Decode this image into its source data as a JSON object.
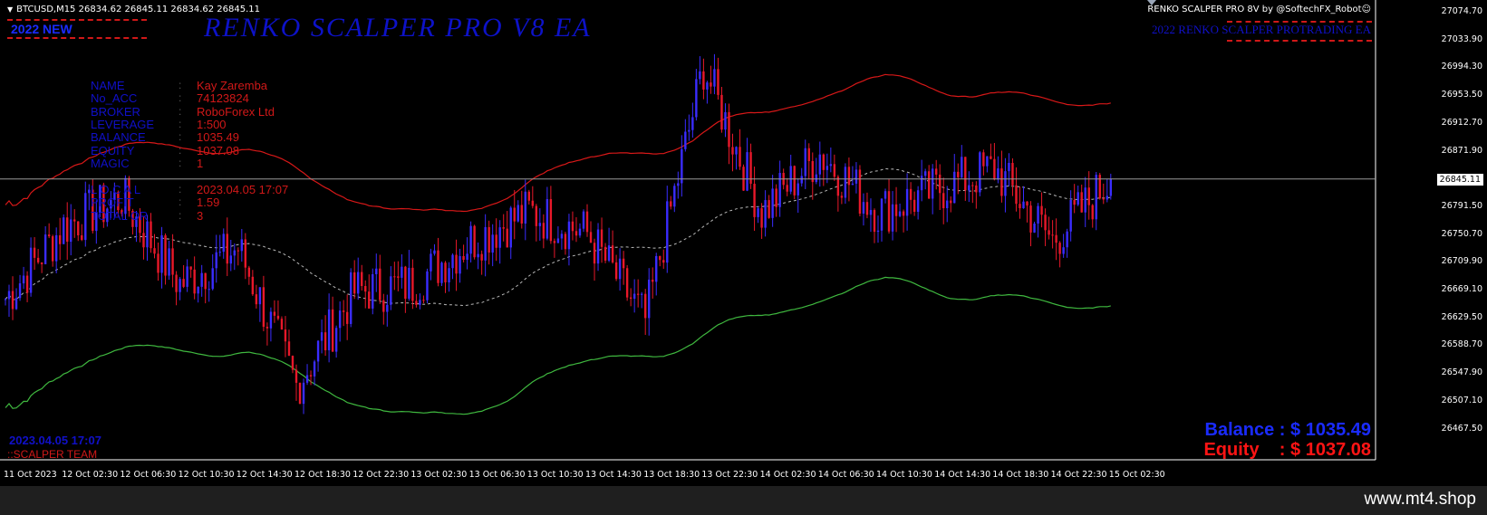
{
  "symbol_bar": {
    "arrow": "▼",
    "text": "BTCUSD,M15  26834.62 26845.11 26834.62 26845.11"
  },
  "overlay": {
    "new_label": "2022 NEW",
    "title": "RENKO SCALPER PRO V8 EA",
    "brand_top": "RENKO SCALPER PRO 8V by @SoftechFX_Robot☺",
    "brand_sub": "2022 RENKO SCALPER PROTRADING EA",
    "balance_text": "Balance : $ 1035.49",
    "equity_text": "Equity    : $ 1037.08",
    "bottom_date": "2023.04.05 17:07",
    "bottom_team": "::SCALPER TEAM"
  },
  "account_info": [
    {
      "label": "NAME",
      "colon": ":",
      "value": "Kay Zaremba"
    },
    {
      "label": "No_ACC",
      "colon": ":",
      "value": "74123824"
    },
    {
      "label": "BROKER",
      "colon": ":",
      "value": "RoboForex Ltd"
    },
    {
      "label": "LEVERAGE",
      "colon": ":",
      "value": "1:500"
    },
    {
      "label": "BALANCE",
      "colon": ":",
      "value": "1035.49"
    },
    {
      "label": "EQUITY",
      "colon": ":",
      "value": "1037.08"
    },
    {
      "label": "MAGIC",
      "colon": ":",
      "value": "1"
    }
  ],
  "trade_info": [
    {
      "label": "L O C A L",
      "colon": ":",
      "value": "2023.04.05 17:07"
    },
    {
      "label": "PROFIT",
      "colon": ":",
      "value": "1.59"
    },
    {
      "label": "TOTAL OR",
      "colon": ":",
      "value": "3"
    }
  ],
  "price_axis": {
    "current": "26845.11",
    "labels": [
      "27074.70",
      "27033.90",
      "26994.30",
      "26953.50",
      "26912.70",
      "26871.90",
      "26832.30",
      "26791.50",
      "26750.70",
      "26709.90",
      "26669.10",
      "26629.50",
      "26588.70",
      "26547.90",
      "26507.10",
      "26467.50"
    ]
  },
  "time_axis": [
    "11 Oct 2023",
    "12 Oct 02:30",
    "12 Oct 06:30",
    "12 Oct 10:30",
    "12 Oct 14:30",
    "12 Oct 18:30",
    "12 Oct 22:30",
    "13 Oct 02:30",
    "13 Oct 06:30",
    "13 Oct 10:30",
    "13 Oct 14:30",
    "13 Oct 18:30",
    "13 Oct 22:30",
    "14 Oct 02:30",
    "14 Oct 06:30",
    "14 Oct 10:30",
    "14 Oct 14:30",
    "14 Oct 18:30",
    "14 Oct 22:30",
    "15 Oct 02:30"
  ],
  "footer": {
    "watermark": "www.mt4.shop"
  },
  "colors": {
    "bull": "#3a2cff",
    "bear": "#e8182a",
    "upper_band": "#d81818",
    "lower_band": "#3fb83f",
    "mid_line": "#b8b8b8",
    "background": "#000000"
  },
  "chart_data": {
    "type": "candlestick",
    "symbol": "BTCUSD",
    "timeframe": "M15",
    "ylim": [
      26467.5,
      27074.7
    ],
    "current_price": 26845.11,
    "close_trajectory": [
      [
        "11 Oct 2023",
        26680
      ],
      [
        "12 Oct 02:30",
        26780
      ],
      [
        "12 Oct 06:30",
        26820
      ],
      [
        "12 Oct 10:30",
        26700
      ],
      [
        "12 Oct 14:30",
        26750
      ],
      [
        "12 Oct 18:30",
        26560
      ],
      [
        "12 Oct 22:30",
        26690
      ],
      [
        "13 Oct 02:30",
        26700
      ],
      [
        "13 Oct 06:30",
        26760
      ],
      [
        "13 Oct 10:30",
        26800
      ],
      [
        "13 Oct 14:30",
        26770
      ],
      [
        "13 Oct 18:30",
        26650
      ],
      [
        "13 Oct 22:30",
        27000
      ],
      [
        "14 Oct 02:30",
        26800
      ],
      [
        "14 Oct 06:30",
        26880
      ],
      [
        "14 Oct 10:30",
        26800
      ],
      [
        "14 Oct 14:30",
        26830
      ],
      [
        "14 Oct 18:30",
        26860
      ],
      [
        "14 Oct 22:30",
        26760
      ],
      [
        "15 Oct 02:30",
        26845
      ]
    ]
  }
}
